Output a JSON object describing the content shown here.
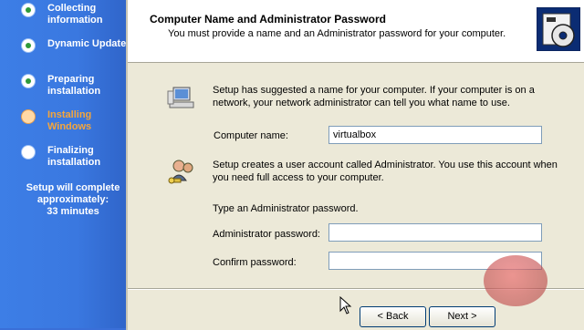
{
  "setup_steps": [
    {
      "label": "Collecting information",
      "state": "done"
    },
    {
      "label": "Dynamic Update",
      "state": "done"
    },
    {
      "label": "Preparing installation",
      "state": "done"
    },
    {
      "label": "Installing Windows",
      "state": "current"
    },
    {
      "label": "Finalizing installation",
      "state": "pending"
    }
  ],
  "eta": {
    "line1": "Setup will complete",
    "line2": "approximately:",
    "line3": "33 minutes"
  },
  "dialog": {
    "title": "Computer Name and Administrator Password",
    "subtitle": "You must provide a name and an Administrator password for your computer.",
    "name_info_1": "Setup has suggested a name for your computer.  If your computer is on a",
    "name_info_2": "network, your network administrator can tell you what name to use.",
    "computer_name_label": "Computer name:",
    "computer_name_value": "virtualbox",
    "admin_info_1": "Setup creates a user account called Administrator.  You use this account when",
    "admin_info_2": "you need full access to your computer.",
    "password_prompt": "Type an Administrator password.",
    "admin_password_label": "Administrator password:",
    "admin_password_value": "",
    "confirm_password_label": "Confirm password:",
    "confirm_password_value": "",
    "back_label": "< Back",
    "next_label": "Next >"
  },
  "colors": {
    "sidebar": "#3a78e0",
    "current_step": "#f6a63a",
    "dialog_bg": "#ece9d8"
  }
}
